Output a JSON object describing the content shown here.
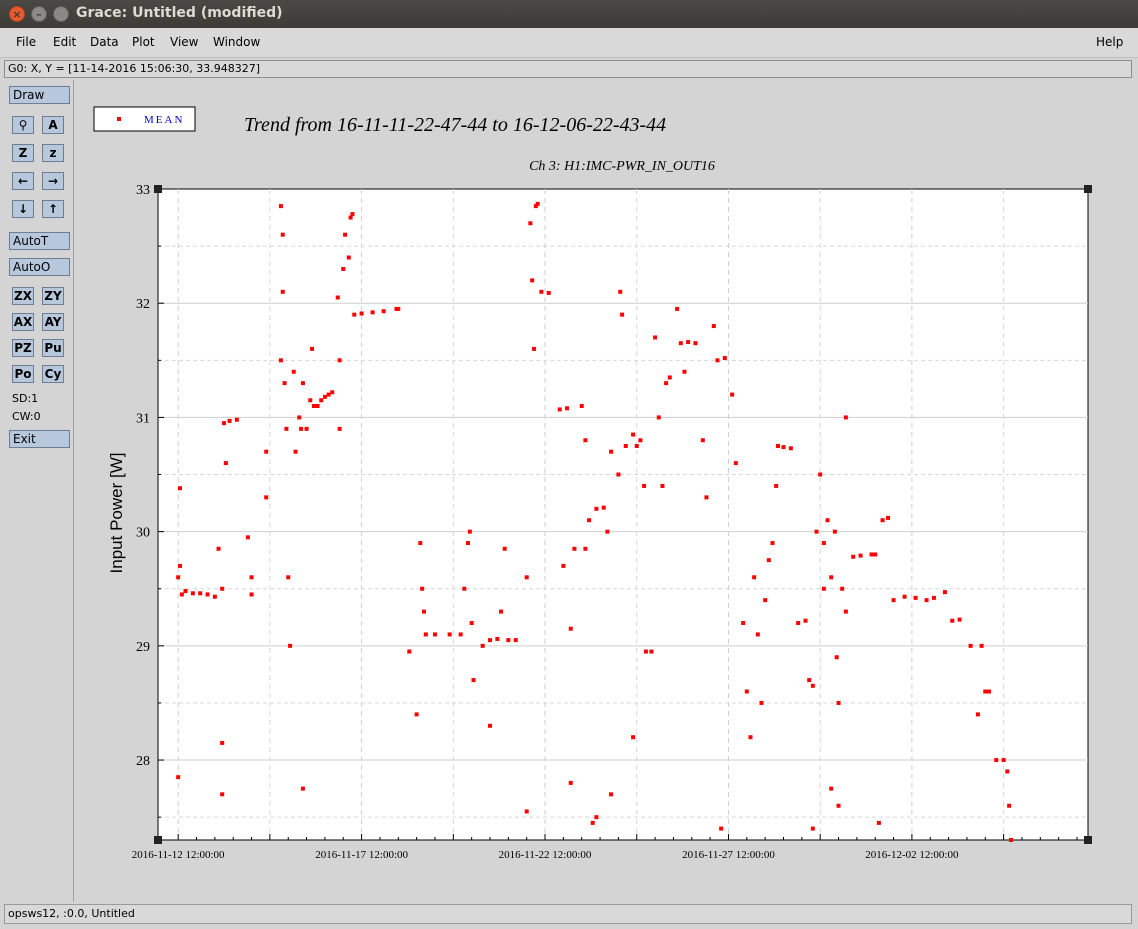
{
  "window": {
    "title": "Grace: Untitled (modified)",
    "close_glyph": "×",
    "min_glyph": "–"
  },
  "menu": {
    "file": "File",
    "edit": "Edit",
    "data": "Data",
    "plot": "Plot",
    "view": "View",
    "window": "Window",
    "help": "Help"
  },
  "coord_readout": "G0: X, Y = [11-14-2016 15:06:30, 33.948327]",
  "toolbox": {
    "draw": "Draw",
    "zoom_glyph": "⚲",
    "autoscale_glyph": "A",
    "zz_glyph": "Z",
    "zsmall_glyph": "z",
    "left_glyph": "←",
    "right_glyph": "→",
    "down_glyph": "↓",
    "up_glyph": "↑",
    "autot": "AutoT",
    "autoo": "AutoO",
    "zx": "ZX",
    "zy": "ZY",
    "ax": "AX",
    "ay": "AY",
    "pz": "PZ",
    "pu": "Pu",
    "po": "Po",
    "cy": "Cy",
    "sd": "SD:1",
    "cw": "CW:0",
    "exit": "Exit"
  },
  "status": "opsws12, :0.0, Untitled",
  "colors": {
    "series": "#ff0000",
    "legend_text": "#0000cc"
  },
  "chart_data": {
    "type": "scatter",
    "title": "Trend from 16-11-11-22-47-44 to 16-12-06-22-43-44",
    "subtitle": "Ch 3: H1:IMC-PWR_IN_OUT16",
    "ylabel": "Input Power [W]",
    "xlabel": "",
    "ylim": [
      27.3,
      33
    ],
    "y_ticks": [
      "28",
      "29",
      "30",
      "31",
      "32",
      "33"
    ],
    "x_ticks": [
      "2016-11-12 12:00:00",
      "2016-11-17 12:00:00",
      "2016-11-22 12:00:00",
      "2016-11-27 12:00:00",
      "2016-12-02 12:00:00"
    ],
    "x_range_days": [
      -0.55,
      24.8
    ],
    "grid": true,
    "legend": {
      "label": "MEAN",
      "position": "top-left"
    },
    "series": [
      {
        "name": "MEAN",
        "points": [
          [
            0.0,
            29.6
          ],
          [
            0.05,
            29.7
          ],
          [
            0.1,
            29.45
          ],
          [
            0.2,
            29.48
          ],
          [
            0.4,
            29.46
          ],
          [
            0.6,
            29.46
          ],
          [
            0.8,
            29.45
          ],
          [
            1.0,
            29.43
          ],
          [
            1.1,
            29.85
          ],
          [
            1.2,
            29.5
          ],
          [
            1.25,
            30.95
          ],
          [
            1.3,
            30.6
          ],
          [
            1.4,
            30.97
          ],
          [
            1.6,
            30.98
          ],
          [
            1.9,
            29.95
          ],
          [
            2.0,
            29.6
          ],
          [
            2.0,
            29.45
          ],
          [
            2.4,
            30.7
          ],
          [
            2.4,
            30.3
          ],
          [
            2.8,
            31.5
          ],
          [
            2.8,
            32.85
          ],
          [
            2.85,
            32.6
          ],
          [
            2.85,
            32.1
          ],
          [
            2.9,
            31.3
          ],
          [
            2.95,
            30.9
          ],
          [
            3.0,
            29.6
          ],
          [
            3.05,
            29.0
          ],
          [
            3.15,
            31.4
          ],
          [
            3.2,
            30.7
          ],
          [
            3.3,
            31.0
          ],
          [
            3.35,
            30.9
          ],
          [
            3.4,
            31.3
          ],
          [
            3.5,
            30.9
          ],
          [
            3.6,
            31.15
          ],
          [
            3.65,
            31.6
          ],
          [
            3.7,
            31.1
          ],
          [
            3.8,
            31.1
          ],
          [
            3.9,
            31.15
          ],
          [
            4.0,
            31.18
          ],
          [
            4.1,
            31.2
          ],
          [
            4.2,
            31.22
          ],
          [
            4.35,
            32.05
          ],
          [
            4.4,
            31.5
          ],
          [
            4.4,
            30.9
          ],
          [
            4.5,
            32.3
          ],
          [
            4.55,
            32.6
          ],
          [
            4.65,
            32.4
          ],
          [
            4.7,
            32.75
          ],
          [
            4.75,
            32.78
          ],
          [
            4.8,
            31.9
          ],
          [
            5.0,
            31.91
          ],
          [
            5.3,
            31.92
          ],
          [
            5.6,
            31.93
          ],
          [
            5.95,
            31.95
          ],
          [
            6.0,
            31.95
          ],
          [
            6.3,
            28.95
          ],
          [
            6.5,
            28.4
          ],
          [
            6.6,
            29.9
          ],
          [
            6.65,
            29.5
          ],
          [
            6.7,
            29.3
          ],
          [
            6.75,
            29.1
          ],
          [
            7.0,
            29.1
          ],
          [
            7.4,
            29.1
          ],
          [
            7.7,
            29.1
          ],
          [
            7.8,
            29.5
          ],
          [
            7.9,
            29.9
          ],
          [
            7.95,
            30.0
          ],
          [
            8.0,
            29.2
          ],
          [
            8.05,
            28.7
          ],
          [
            8.3,
            29.0
          ],
          [
            8.5,
            29.05
          ],
          [
            8.7,
            29.06
          ],
          [
            8.8,
            29.3
          ],
          [
            8.9,
            29.85
          ],
          [
            9.0,
            29.05
          ],
          [
            9.2,
            29.05
          ],
          [
            9.5,
            29.6
          ],
          [
            9.6,
            32.7
          ],
          [
            9.65,
            32.2
          ],
          [
            9.7,
            31.6
          ],
          [
            9.75,
            32.85
          ],
          [
            9.8,
            32.87
          ],
          [
            9.9,
            32.1
          ],
          [
            10.1,
            32.09
          ],
          [
            10.4,
            31.07
          ],
          [
            10.6,
            31.08
          ],
          [
            10.5,
            29.7
          ],
          [
            10.7,
            29.15
          ],
          [
            10.8,
            29.85
          ],
          [
            11.0,
            31.1
          ],
          [
            11.1,
            29.85
          ],
          [
            11.1,
            30.8
          ],
          [
            11.2,
            30.1
          ],
          [
            11.4,
            30.2
          ],
          [
            11.6,
            30.21
          ],
          [
            11.7,
            30.0
          ],
          [
            11.8,
            30.7
          ],
          [
            12.0,
            30.5
          ],
          [
            12.05,
            32.1
          ],
          [
            12.1,
            31.9
          ],
          [
            12.2,
            30.75
          ],
          [
            12.4,
            30.85
          ],
          [
            12.5,
            30.75
          ],
          [
            12.6,
            30.8
          ],
          [
            12.7,
            30.4
          ],
          [
            12.75,
            28.95
          ],
          [
            12.9,
            28.95
          ],
          [
            13.0,
            31.7
          ],
          [
            13.1,
            31.0
          ],
          [
            13.2,
            30.4
          ],
          [
            13.3,
            31.3
          ],
          [
            13.4,
            31.35
          ],
          [
            13.6,
            31.95
          ],
          [
            13.7,
            31.65
          ],
          [
            13.8,
            31.4
          ],
          [
            13.9,
            31.66
          ],
          [
            14.1,
            31.65
          ],
          [
            14.3,
            30.8
          ],
          [
            14.4,
            30.3
          ],
          [
            14.6,
            31.8
          ],
          [
            14.7,
            31.5
          ],
          [
            14.9,
            31.52
          ],
          [
            15.1,
            31.2
          ],
          [
            15.2,
            30.6
          ],
          [
            15.4,
            29.2
          ],
          [
            15.5,
            28.6
          ],
          [
            15.6,
            28.2
          ],
          [
            15.7,
            29.6
          ],
          [
            15.8,
            29.1
          ],
          [
            15.9,
            28.5
          ],
          [
            16.0,
            29.4
          ],
          [
            16.1,
            29.75
          ],
          [
            16.2,
            29.9
          ],
          [
            16.3,
            30.4
          ],
          [
            16.35,
            30.75
          ],
          [
            16.5,
            30.74
          ],
          [
            16.7,
            30.73
          ],
          [
            16.9,
            29.2
          ],
          [
            17.1,
            29.22
          ],
          [
            17.2,
            28.7
          ],
          [
            17.3,
            28.65
          ],
          [
            17.4,
            30.0
          ],
          [
            17.5,
            30.5
          ],
          [
            17.6,
            29.5
          ],
          [
            17.6,
            29.9
          ],
          [
            17.7,
            30.1
          ],
          [
            17.8,
            29.6
          ],
          [
            17.9,
            30.0
          ],
          [
            17.95,
            28.9
          ],
          [
            18.0,
            28.5
          ],
          [
            18.1,
            29.5
          ],
          [
            18.2,
            29.3
          ],
          [
            18.2,
            31.0
          ],
          [
            18.4,
            29.78
          ],
          [
            18.6,
            29.79
          ],
          [
            18.9,
            29.8
          ],
          [
            19.0,
            29.8
          ],
          [
            19.2,
            30.1
          ],
          [
            19.35,
            30.12
          ],
          [
            19.5,
            29.4
          ],
          [
            19.8,
            29.43
          ],
          [
            20.1,
            29.42
          ],
          [
            20.4,
            29.4
          ],
          [
            20.6,
            29.42
          ],
          [
            20.9,
            29.47
          ],
          [
            21.1,
            29.22
          ],
          [
            21.3,
            29.23
          ],
          [
            21.6,
            29.0
          ],
          [
            21.8,
            28.4
          ],
          [
            21.9,
            29.0
          ],
          [
            22.0,
            28.6
          ],
          [
            22.1,
            28.6
          ],
          [
            22.3,
            28.0
          ],
          [
            22.5,
            28.0
          ],
          [
            22.6,
            27.9
          ],
          [
            22.65,
            27.6
          ],
          [
            22.7,
            27.3
          ],
          [
            0.0,
            27.85
          ],
          [
            0.05,
            30.38
          ],
          [
            1.2,
            28.15
          ],
          [
            1.2,
            27.7
          ],
          [
            3.4,
            27.75
          ],
          [
            9.5,
            27.55
          ],
          [
            11.3,
            27.45
          ],
          [
            11.4,
            27.5
          ],
          [
            11.8,
            27.7
          ],
          [
            12.4,
            28.2
          ],
          [
            14.8,
            27.4
          ],
          [
            17.3,
            27.4
          ],
          [
            17.8,
            27.75
          ],
          [
            18.0,
            27.6
          ],
          [
            19.1,
            27.45
          ],
          [
            8.5,
            28.3
          ],
          [
            10.7,
            27.8
          ]
        ]
      }
    ]
  }
}
